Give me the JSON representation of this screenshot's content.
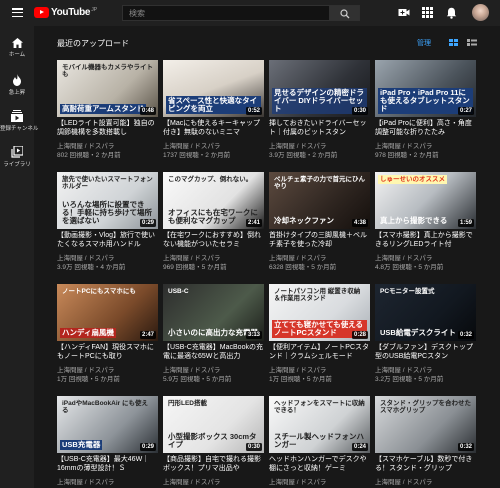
{
  "header": {
    "logo_text": "YouTube",
    "logo_sup": "JP",
    "search_placeholder": "検索"
  },
  "sidebar": {
    "items": [
      {
        "label": "ホーム",
        "icon": "home-icon"
      },
      {
        "label": "急上昇",
        "icon": "flame-icon"
      },
      {
        "label": "登録チャンネル",
        "icon": "subscriptions-icon"
      },
      {
        "label": "ライブラリ",
        "icon": "library-icon"
      }
    ]
  },
  "section": {
    "title": "最近のアップロード",
    "manage_label": "管理"
  },
  "colors": {
    "accent": "#3ea6ff",
    "brand": "#ff0000"
  },
  "videos": [
    {
      "title": "【LEDライト設置可能】独自の調節機構を多数搭載し",
      "channel": "上海問屋 / ドスパラ",
      "meta": "802 回視聴・2 か月前",
      "duration": "0:48",
      "thumb_top": "モバイル機器もカメラやライトも",
      "thumb_bottom": "高耐荷重アームスタンド",
      "bg": "linear-gradient(135deg,#e9e6e0 0%,#b8b2a6 60%,#5a5348 100%)",
      "t1c": "#222",
      "t1bg": "transparent",
      "t2c": "#fff",
      "t2bg": "#1c3d78"
    },
    {
      "title": "【Macにも使えるキーキャップ付き】無駄のないミニマ",
      "channel": "上海問屋 / ドスパラ",
      "meta": "1737 回視聴・2 か月前",
      "duration": "0:52",
      "thumb_top": "",
      "thumb_bottom": "省スペース性と快適なタイピングを両立",
      "bg": "linear-gradient(160deg,#f3efe9 0%,#d7d0c6 50%,#3a3633 100%)",
      "t1c": "#222",
      "t1bg": "transparent",
      "t2c": "#fff",
      "t2bg": "#1c3d78"
    },
    {
      "title": "挿しておきたいドライバーセット｜付属のビットスタン",
      "channel": "上海問屋 / ドスパラ",
      "meta": "3.9万 回視聴・2 か月前",
      "duration": "0:30",
      "thumb_top": "",
      "thumb_bottom": "見せるデザインの精密ドライバー DIYドライバーセット",
      "bg": "linear-gradient(135deg,#6b6f78 0%,#2f3238 60%,#18191c 100%)",
      "t1c": "#fff",
      "t1bg": "transparent",
      "t2c": "#fff",
      "t2bg": "rgba(30,60,120,0.8)"
    },
    {
      "title": "【iPad Proに便利】高さ・角度調整可能な折りたたみ",
      "channel": "上海問屋 / ドスパラ",
      "meta": "978 回視聴・2 か月前",
      "duration": "0:27",
      "thumb_top": "",
      "thumb_bottom": "iPad Pro・iPad Pro 11にも使えるタブレットスタンド",
      "bg": "linear-gradient(135deg,#9aa4ad 0%,#4b535b 60%,#23272c 100%)",
      "t1c": "#fff",
      "t1bg": "transparent",
      "t2c": "#fff",
      "t2bg": "#1c3d78"
    },
    {
      "title": "【動画撮影・Vlog】旅行で使いたくなるスマホ用ハンドル",
      "channel": "上海問屋 / ドスパラ",
      "meta": "3.9万 回視聴・4 か月前",
      "duration": "0:29",
      "thumb_top": "旅先で使いたいスマートフォンホルダー",
      "thumb_bottom": "いろんな場所に設置できる！手軽に持ち歩けて場所を選ばない",
      "bg": "linear-gradient(135deg,#f2f2f2 0%,#cfd3d6 60%,#8d9398 100%)",
      "t1c": "#222",
      "t1bg": "transparent",
      "t2c": "#222",
      "t2bg": "transparent"
    },
    {
      "title": "【在宅ワークにおすすめ】倒れない機能がついたセラミ",
      "channel": "上海問屋 / ドスパラ",
      "meta": "969 回視聴・5 か月前",
      "duration": "2:41",
      "thumb_top": "このマグカップ、倒れない。",
      "thumb_bottom": "オフィスにも在宅ワークにも便利なマグカップ",
      "bg": "linear-gradient(135deg,#fafafa 0%,#e2e2e2 60%,#1a1a1a 100%)",
      "t1c": "#222",
      "t1bg": "transparent",
      "t2c": "#222",
      "t2bg": "transparent"
    },
    {
      "title": "首掛けタイプの三脚風機＋ベルチ素子を使った冷却",
      "channel": "上海問屋 / ドスパラ",
      "meta": "6328 回視聴・5 か月前",
      "duration": "4:38",
      "thumb_top": "ペルチェ素子の力で首元にひんやり",
      "thumb_bottom": "冷却ネックファン",
      "bg": "linear-gradient(135deg,#5c4a3f 0%,#2e2520 60%,#140f0c 100%)",
      "t1c": "#fff",
      "t1bg": "transparent",
      "t2c": "#fff",
      "t2bg": "transparent"
    },
    {
      "title": "【スマホ撮影】真上から撮影できるリングLEDライト付",
      "channel": "上海問屋 / ドスパラ",
      "meta": "4.8万 回視聴・5 か月前",
      "duration": "1:59",
      "thumb_top": "しゅーせいのオススメ",
      "thumb_bottom": "真上から撮影できる",
      "bg": "linear-gradient(135deg,#f3f3f3 0%,#b7bcc1 50%,#2a2e33 100%)",
      "t1c": "#e0351c",
      "t1bg": "#fff7b0",
      "t2c": "#fff",
      "t2bg": "transparent"
    },
    {
      "title": "【ハンディFAN】現役スマホにもノートPCにも取り",
      "channel": "上海問屋 / ドスパラ",
      "meta": "1万 回視聴・5 か月前",
      "duration": "2:47",
      "thumb_top": "ノートPCにもスマホにも",
      "thumb_bottom": "ハンディ扇風機",
      "bg": "linear-gradient(135deg,#c98a5a 0%,#7a4a2a 60%,#2b1a10 100%)",
      "t1c": "#fff",
      "t1bg": "transparent",
      "t2c": "#fff",
      "t2bg": "#b3261e"
    },
    {
      "title": "【USB-C充電器】MacBookの充電に最適な65Wと高出力",
      "channel": "上海問屋 / ドスパラ",
      "meta": "5.9万 回視聴・5 か月前",
      "duration": "3:13",
      "thumb_top": "USB-C",
      "thumb_bottom": "小さいのに高出力な充電器",
      "bg": "linear-gradient(135deg,#2d2d2d 0%,#4d5a4a 60%,#1c1f1a 100%)",
      "t1c": "#fff",
      "t1bg": "transparent",
      "t2c": "#fff",
      "t2bg": "transparent"
    },
    {
      "title": "【便利アイテム】ノートPCスタンド｜クラムシェルモード",
      "channel": "上海問屋 / ドスパラ",
      "meta": "1万 回視聴・5 か月前",
      "duration": "0:28",
      "thumb_top": "ノートパソコン用 縦置き収納＆作業用スタンド",
      "thumb_bottom": "立てても寝かせても使えるノートPCスタンド",
      "bg": "linear-gradient(135deg,#f5f5f5 0%,#d9dcdf 60%,#aab0b6 100%)",
      "t1c": "#222",
      "t1bg": "transparent",
      "t2c": "#fff",
      "t2bg": "#d6362a"
    },
    {
      "title": "【ダブルファン】デスクトップ型のUSB給電PCスタン",
      "channel": "上海問屋 / ドスパラ",
      "meta": "3.2万 回視聴・5 か月前",
      "duration": "0:32",
      "thumb_top": "PCモニター設置式",
      "thumb_bottom": "USB給電デスクライト",
      "bg": "linear-gradient(135deg,#1d2530 0%,#121820 60%,#07090c 100%)",
      "t1c": "#fff",
      "t1bg": "transparent",
      "t2c": "#fff",
      "t2bg": "transparent"
    },
    {
      "title": "【USB-C充電器】最大46W｜16mmの薄型設計！Ｓ",
      "channel": "上海問屋 / ドスパラ",
      "meta": "",
      "duration": "0:29",
      "thumb_top": "iPadやMacBookAir にも使える",
      "thumb_bottom": "USB充電器",
      "bg": "linear-gradient(135deg,#e6e8ea 0%,#8d9399 60%,#2c3136 100%)",
      "t1c": "#222",
      "t1bg": "transparent",
      "t2c": "#fff",
      "t2bg": "#1c3d78"
    },
    {
      "title": "【商品撮影】自宅で撮れる撮影ボックス！プリマ出品や",
      "channel": "上海問屋 / ドスパラ",
      "meta": "",
      "duration": "0:30",
      "thumb_top": "円形LED搭載",
      "thumb_bottom": "小型撮影ボックス 30cmタイプ",
      "bg": "linear-gradient(135deg,#f6f6f6 0%,#e4e4e4 60%,#b5b5b5 100%)",
      "t1c": "#222",
      "t1bg": "transparent",
      "t2c": "#222",
      "t2bg": "transparent"
    },
    {
      "title": "ヘッドホンハンガーでデスクや棚にさっと収納！ゲーミ",
      "channel": "上海問屋 / ドスパラ",
      "meta": "",
      "duration": "0:24",
      "thumb_top": "ヘッドフォンをスマートに収納できる！",
      "thumb_bottom": "スチール製ヘッドフォンハンガー",
      "bg": "linear-gradient(135deg,#fafafa 0%,#cfd2d4 60%,#5b5f62 100%)",
      "t1c": "#222",
      "t1bg": "transparent",
      "t2c": "#222",
      "t2bg": "transparent"
    },
    {
      "title": "【スマホケーブル】数秒で付きる！スタンド・グリップ",
      "channel": "上海問屋 / ドスパラ",
      "meta": "",
      "duration": "0:32",
      "thumb_top": "スタンド・グリップを合わせたスマホグリップ",
      "thumb_bottom": "",
      "bg": "linear-gradient(135deg,#d8dadc 0%,#8a8f94 60%,#2b2f33 100%)",
      "t1c": "#222",
      "t1bg": "transparent",
      "t2c": "#fff",
      "t2bg": "transparent"
    }
  ]
}
